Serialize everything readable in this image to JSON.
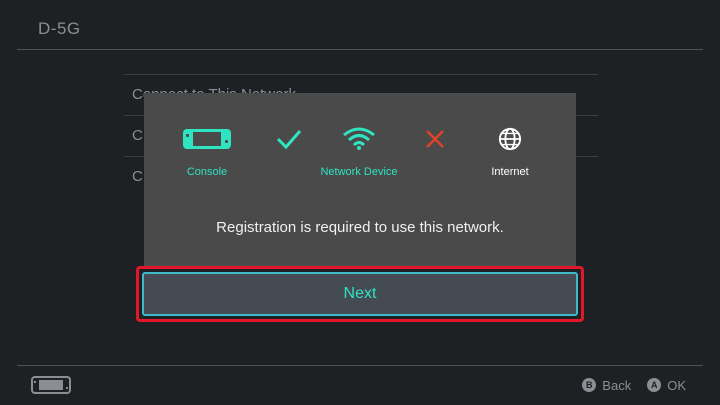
{
  "header": {
    "title": "D-5G"
  },
  "network_menu": {
    "items": [
      "Connect to This Network",
      "C",
      "C"
    ]
  },
  "dialog": {
    "steps": [
      {
        "label": "Console",
        "icon": "console-icon",
        "color": "#2fe4c1"
      },
      {
        "label": "",
        "icon": "check-icon",
        "status": "success",
        "color": "#2fe4c1"
      },
      {
        "label": "Network Device",
        "icon": "wifi-icon",
        "color": "#2fe4c1"
      },
      {
        "label": "",
        "icon": "cross-icon",
        "status": "failed",
        "color": "#e0412a"
      },
      {
        "label": "Internet",
        "icon": "globe-icon",
        "color": "#ffffff"
      }
    ],
    "message": "Registration is required to use this network.",
    "next_label": "Next"
  },
  "footer": {
    "console_icon": "console-icon",
    "back": {
      "glyph": "B",
      "label": "Back"
    },
    "ok": {
      "glyph": "A",
      "label": "OK"
    }
  },
  "colors": {
    "accent": "#2fe4c1",
    "error": "#e0412a",
    "highlight_outline": "#e3162b",
    "background": "#1e2124",
    "dialog": "#4a4a4a"
  }
}
